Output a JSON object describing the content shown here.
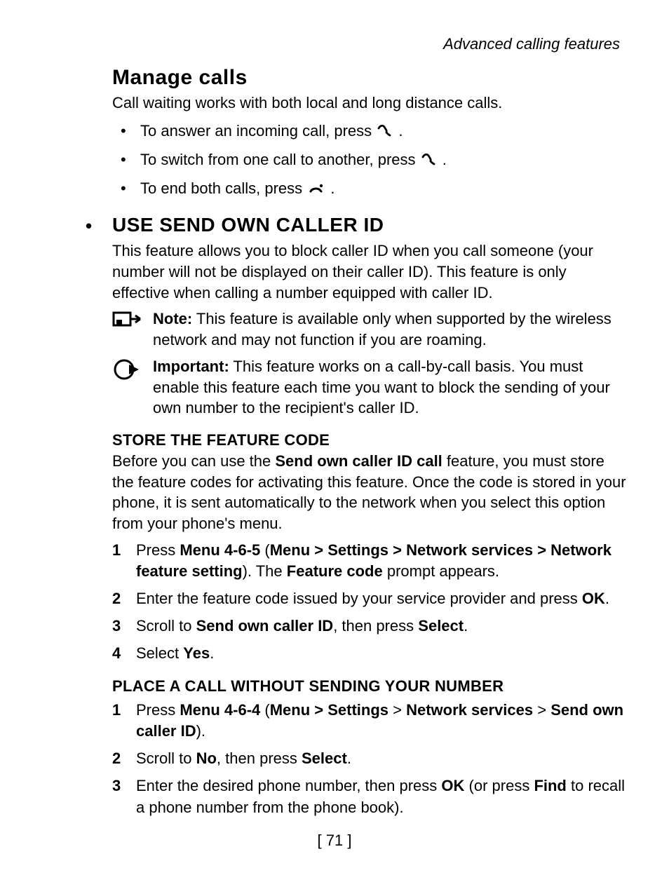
{
  "header": {
    "section": "Advanced calling features"
  },
  "manage": {
    "title": "Manage calls",
    "intro": "Call waiting works with both local and long distance calls.",
    "bullets": [
      {
        "pre": "To answer an incoming call, press ",
        "icon": "call",
        "post": "."
      },
      {
        "pre": "To switch from one call to another, press ",
        "icon": "call",
        "post": "."
      },
      {
        "pre": "To end both calls, press ",
        "icon": "end",
        "post": "."
      }
    ]
  },
  "caller_id": {
    "title": "USE SEND OWN CALLER ID",
    "intro": "This feature allows you to block caller ID when you call someone (your number will not be displayed on their caller ID). This feature is only effective when calling a number equipped with caller ID.",
    "note_label": "Note:",
    "note_text": " This feature is available only when supported by the wireless network and may not function if you are roaming.",
    "important_label": "Important:",
    "important_text": " This feature works on a call-by-call basis. You must enable this feature each time you want to block the sending of your own number to the recipient's caller ID.",
    "store": {
      "title": "STORE THE FEATURE CODE",
      "intro_pre": "Before you can use the ",
      "intro_bold": "Send own caller ID call",
      "intro_post": " feature, you must store the feature codes for activating this feature. Once the code is stored in your phone, it is sent automatically to the network when you select this option from your phone's menu.",
      "steps": {
        "s1_pre": "Press ",
        "s1_b1": "Menu 4-6-5",
        "s1_mid1": " (",
        "s1_b2": "Menu > Settings > Network services > Network feature setting",
        "s1_mid2": "). The ",
        "s1_b3": "Feature code",
        "s1_post": " prompt appears.",
        "s2_pre": "Enter the feature code issued by your service provider and press ",
        "s2_b1": "OK",
        "s2_post": ".",
        "s3_pre": "Scroll to ",
        "s3_b1": "Send own caller ID",
        "s3_mid": ", then press ",
        "s3_b2": "Select",
        "s3_post": ".",
        "s4_pre": "Select ",
        "s4_b1": "Yes",
        "s4_post": "."
      }
    },
    "place": {
      "title": "PLACE A CALL WITHOUT SENDING YOUR NUMBER",
      "steps": {
        "s1_pre": "Press ",
        "s1_b1": "Menu 4-6-4",
        "s1_mid1": " (",
        "s1_b2": "Menu > Settings",
        "s1_gt1": " > ",
        "s1_b3": "Network services",
        "s1_gt2": " > ",
        "s1_b4": "Send own caller ID",
        "s1_post": ").",
        "s2_pre": "Scroll to ",
        "s2_b1": "No",
        "s2_mid": ", then press ",
        "s2_b2": "Select",
        "s2_post": ".",
        "s3_pre": "Enter the desired phone number, then press ",
        "s3_b1": "OK",
        "s3_mid": " (or press ",
        "s3_b2": "Find",
        "s3_post": " to recall a phone number from the phone book)."
      }
    }
  },
  "page_number": "[ 71 ]"
}
